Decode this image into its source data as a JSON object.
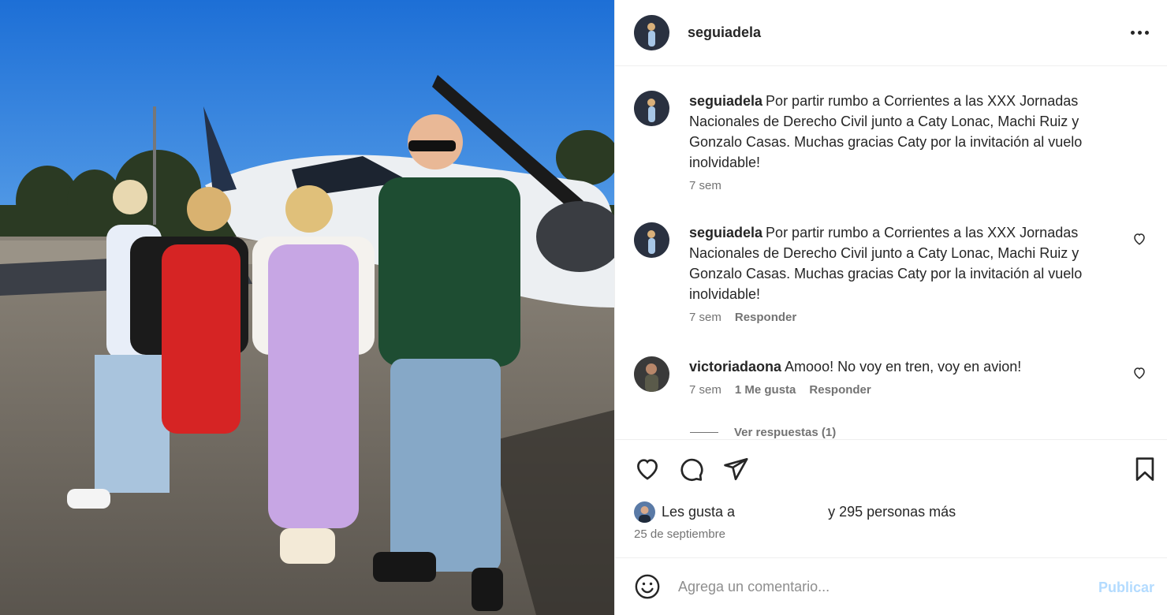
{
  "post": {
    "username": "seguiadela",
    "more_icon": "more-horizontal-icon"
  },
  "comments": [
    {
      "user": "seguiadela",
      "text": "Por partir rumbo a Corrientes a las XXX Jornadas Nacionales de Derecho Civil junto a Caty Lonac, Machi Ruiz y Gonzalo Casas. Muchas gracias Caty por la invitación al vuelo inolvidable!",
      "time": "7 sem"
    },
    {
      "user": "seguiadela",
      "text": "Por partir rumbo a Corrientes a las XXX Jornadas Nacionales de Derecho Civil junto a Caty Lonac, Machi Ruiz y Gonzalo Casas. Muchas gracias Caty por la invitación al vuelo inolvidable!",
      "time": "7 sem",
      "reply": "Responder"
    },
    {
      "user": "victoriadaona",
      "text": "Amooo! No voy en tren, voy en avion!",
      "time": "7 sem",
      "likes": "1 Me gusta",
      "reply": "Responder",
      "view_replies": "Ver respuestas (1)"
    }
  ],
  "likes": {
    "prefix": "Les gusta a",
    "suffix": "y 295 personas más"
  },
  "date": "25 de septiembre",
  "composer": {
    "placeholder": "Agrega un comentario...",
    "publish": "Publicar"
  },
  "colors": {
    "text": "#262626",
    "secondary": "#737373",
    "publish": "#b3dbff",
    "border": "#efefef"
  }
}
